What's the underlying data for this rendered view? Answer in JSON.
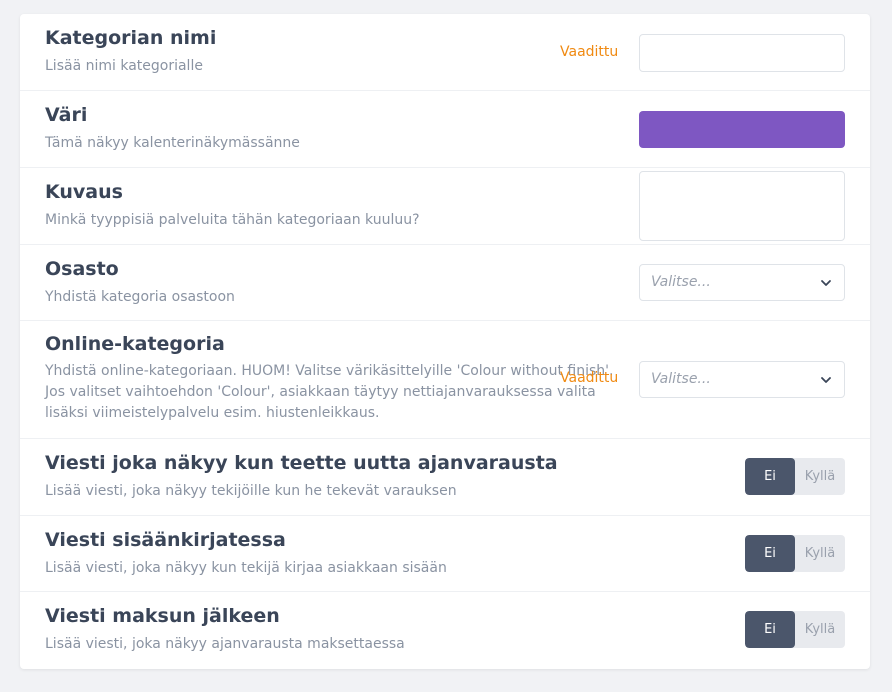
{
  "fields": [
    {
      "title": "Kategorian nimi",
      "description": "Lisää nimi kategorialle",
      "required_label": "Vaadittu",
      "input_value": ""
    },
    {
      "title": "Väri",
      "description": "Tämä näkyy kalenterinäkymässänne",
      "color": "#7e57c2"
    },
    {
      "title": "Kuvaus",
      "description": "Minkä tyyppisiä palveluita tähän kategoriaan kuuluu?",
      "input_value": ""
    },
    {
      "title": "Osasto",
      "description": "Yhdistä kategoria osastoon",
      "select_placeholder": "Valitse..."
    },
    {
      "title": "Online-kategoria",
      "description": "Yhdistä online-kategoriaan. HUOM! Valitse värikäsittelyille 'Colour without finish'. Jos valitset vaihtoehdon 'Colour', asiakkaan täytyy nettiajanvarauksessa valita lisäksi viimeistelypalvelu esim. hiustenleikkaus.",
      "required_label": "Vaadittu",
      "select_placeholder": "Valitse..."
    },
    {
      "title": "Viesti joka näkyy kun teette uutta ajanvarausta",
      "description": "Lisää viesti, joka näkyy tekijöille kun he tekevät varauksen",
      "toggle": {
        "off_label": "Ei",
        "on_label": "Kyllä",
        "selected": "Ei"
      }
    },
    {
      "title": "Viesti sisäänkirjatessa",
      "description": "Lisää viesti, joka näkyy kun tekijä kirjaa asiakkaan sisään",
      "toggle": {
        "off_label": "Ei",
        "on_label": "Kyllä",
        "selected": "Ei"
      }
    },
    {
      "title": "Viesti maksun jälkeen",
      "description": "Lisää viesti, joka näkyy ajanvarausta maksettaessa",
      "toggle": {
        "off_label": "Ei",
        "on_label": "Kyllä",
        "selected": "Ei"
      }
    }
  ]
}
